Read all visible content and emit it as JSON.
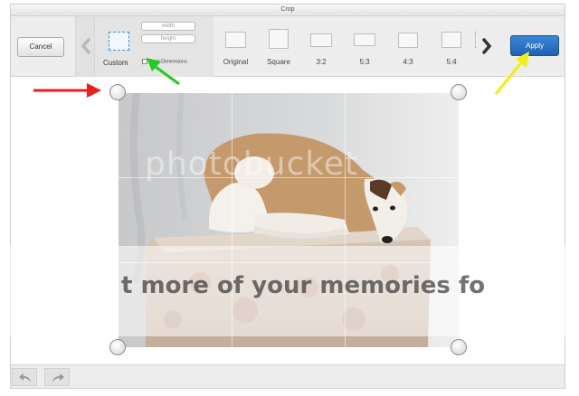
{
  "window": {
    "title": "Crop"
  },
  "toolbar": {
    "cancel_label": "Cancel",
    "apply_label": "Apply",
    "custom": {
      "label": "Custom",
      "width_placeholder": "width",
      "height_placeholder": "height",
      "lock_label": "Lock Dimensions"
    },
    "presets": [
      {
        "label": "Original"
      },
      {
        "label": "Square"
      },
      {
        "label": "3:2"
      },
      {
        "label": "5:3"
      },
      {
        "label": "4:3"
      },
      {
        "label": "5:4"
      }
    ]
  },
  "watermark": {
    "logo_text": "photobucket",
    "banner_text": "t more of your memories fo"
  },
  "colors": {
    "apply_button": "#2a72c6",
    "crop_thumb_selected": "#3d8fd8",
    "annotation_red": "#ee1c1c",
    "annotation_green": "#22cc22",
    "annotation_yellow": "#f2ef10"
  },
  "icons": {
    "nav_left": "chevron-left-icon",
    "nav_right": "chevron-right-icon",
    "undo": "undo-icon",
    "redo": "redo-icon"
  }
}
